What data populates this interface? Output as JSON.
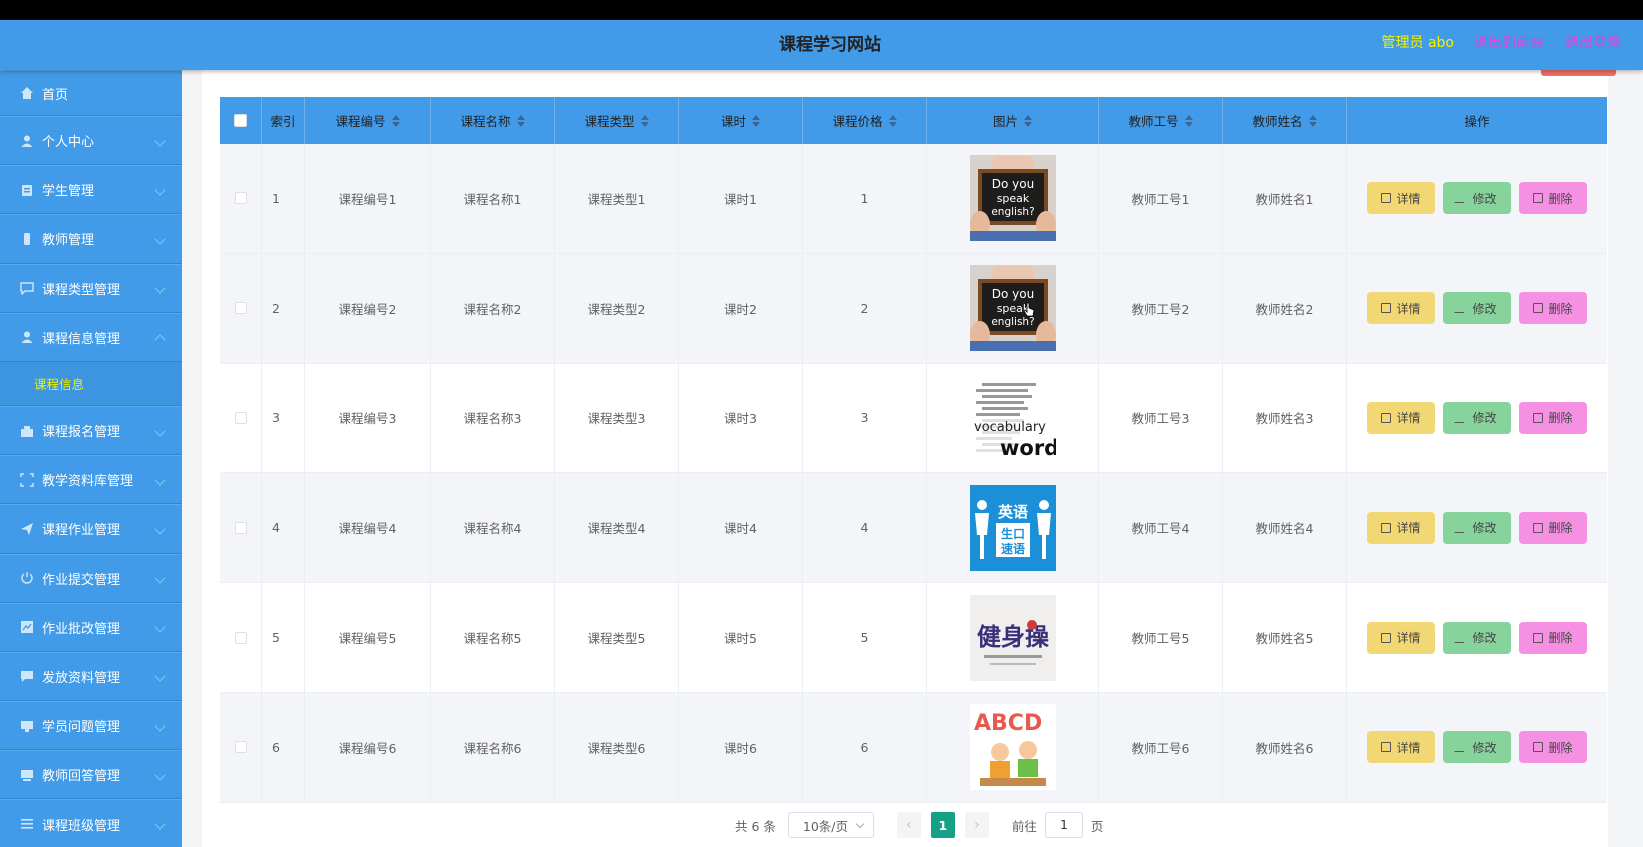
{
  "header": {
    "title": "课程学习网站",
    "admin_label": "管理员 abo",
    "back_label": "退出到前台",
    "logout_label": "退出登录"
  },
  "sidebar": {
    "items": [
      {
        "label": "首页",
        "icon": "home-icon"
      },
      {
        "label": "个人中心",
        "icon": "user-icon"
      },
      {
        "label": "学生管理",
        "icon": "student-icon"
      },
      {
        "label": "教师管理",
        "icon": "teacher-icon"
      },
      {
        "label": "课程类型管理",
        "icon": "chat-icon"
      },
      {
        "label": "课程信息管理",
        "icon": "course-icon",
        "expanded": true
      },
      {
        "label": "课程报名管理",
        "icon": "signup-icon"
      },
      {
        "label": "教学资料库管理",
        "icon": "library-icon"
      },
      {
        "label": "课程作业管理",
        "icon": "send-icon"
      },
      {
        "label": "作业提交管理",
        "icon": "power-icon"
      },
      {
        "label": "作业批改管理",
        "icon": "grade-icon"
      },
      {
        "label": "发放资料管理",
        "icon": "message-icon"
      },
      {
        "label": "学员问题管理",
        "icon": "question-icon"
      },
      {
        "label": "教师回答管理",
        "icon": "answer-icon"
      },
      {
        "label": "课程班级管理",
        "icon": "list-icon"
      }
    ],
    "submenu": {
      "label": "课程信息"
    }
  },
  "table": {
    "columns": [
      "索引",
      "课程编号",
      "课程名称",
      "课程类型",
      "课时",
      "课程价格",
      "图片",
      "教师工号",
      "教师姓名",
      "操作"
    ],
    "rows": [
      {
        "index": "1",
        "code": "课程编号1",
        "name": "课程名称1",
        "type": "课程类型1",
        "hours": "课时1",
        "price": "1",
        "image": "Do you speak english? sign",
        "tno": "教师工号1",
        "tname": "教师姓名1"
      },
      {
        "index": "2",
        "code": "课程编号2",
        "name": "课程名称2",
        "type": "课程类型2",
        "hours": "课时2",
        "price": "2",
        "image": "Do you speak english? sign",
        "tno": "教师工号2",
        "tname": "教师姓名2"
      },
      {
        "index": "3",
        "code": "课程编号3",
        "name": "课程名称3",
        "type": "课程类型3",
        "hours": "课时3",
        "price": "3",
        "image": "vocabulary words collage",
        "tno": "教师工号3",
        "tname": "教师姓名3"
      },
      {
        "index": "4",
        "code": "课程编号4",
        "name": "课程名称4",
        "type": "课程类型4",
        "hours": "课时4",
        "price": "4",
        "image": "英语 生口 速语 poster",
        "tno": "教师工号4",
        "tname": "教师姓名4"
      },
      {
        "index": "5",
        "code": "课程编号5",
        "name": "课程名称5",
        "type": "课程类型5",
        "hours": "课时5",
        "price": "5",
        "image": "健身操 calligraphy",
        "tno": "教师工号5",
        "tname": "教师姓名5"
      },
      {
        "index": "6",
        "code": "课程编号6",
        "name": "课程名称6",
        "type": "课程类型6",
        "hours": "课时6",
        "price": "6",
        "image": "ABCD kids illustration",
        "tno": "教师工号6",
        "tname": "教师姓名6"
      }
    ],
    "actions": {
      "detail": "详情",
      "edit": "修改",
      "delete": "删除"
    }
  },
  "pager": {
    "total": "共 6 条",
    "page_size": "10条/页",
    "prev": "‹",
    "current": "1",
    "next": "›",
    "goto_label": "前往",
    "goto_value": "1",
    "page_unit": "页"
  },
  "images": {
    "row1": {
      "line1": "Do you",
      "line2": "speak",
      "line3": "english?"
    },
    "row2": {
      "line1": "Do you",
      "line2": "speak",
      "line3": "english?"
    },
    "row3": {
      "word1": "vocabulary",
      "word2": "words"
    },
    "row4": {
      "top": "英语",
      "mid": "生口",
      "bot": "速语"
    },
    "row5": {
      "text": "健身操"
    },
    "row6": {
      "letters": "ABCD"
    }
  },
  "colors": {
    "brand_blue": "#419be9",
    "admin_yellow": "#f5f000",
    "link_magenta": "#d64ad6",
    "detail_yellow": "#f2d775",
    "edit_green": "#86d39b",
    "delete_pink": "#f590e3",
    "page_active": "#16a085"
  }
}
